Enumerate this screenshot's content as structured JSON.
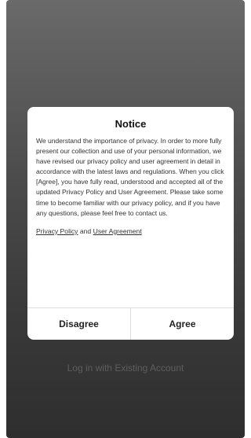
{
  "background": {
    "login_existing_label": "Log in with Existing Account"
  },
  "dialog": {
    "title": "Notice",
    "body": "We understand the importance of privacy. In order to more fully present our collection and use of your personal information, we have revised our privacy policy and user agreement in detail in accordance with the latest laws and regulations. When you click [Agree], you have fully read, understood and accepted all of the updated Privacy Policy and User Agreement. Please take some time to become familiar with our privacy policy, and if you have any questions, please feel free to contact us.",
    "privacy_policy_link": "Privacy Policy",
    "links_conjunction": "and",
    "user_agreement_link": "User Agreement",
    "disagree_label": "Disagree",
    "agree_label": "Agree"
  },
  "colors": {
    "overlay_top": "#6a6a6a",
    "overlay_bottom": "#2e2e2e",
    "dialog_bg": "#ffffff",
    "divider": "#dcdcdc"
  }
}
